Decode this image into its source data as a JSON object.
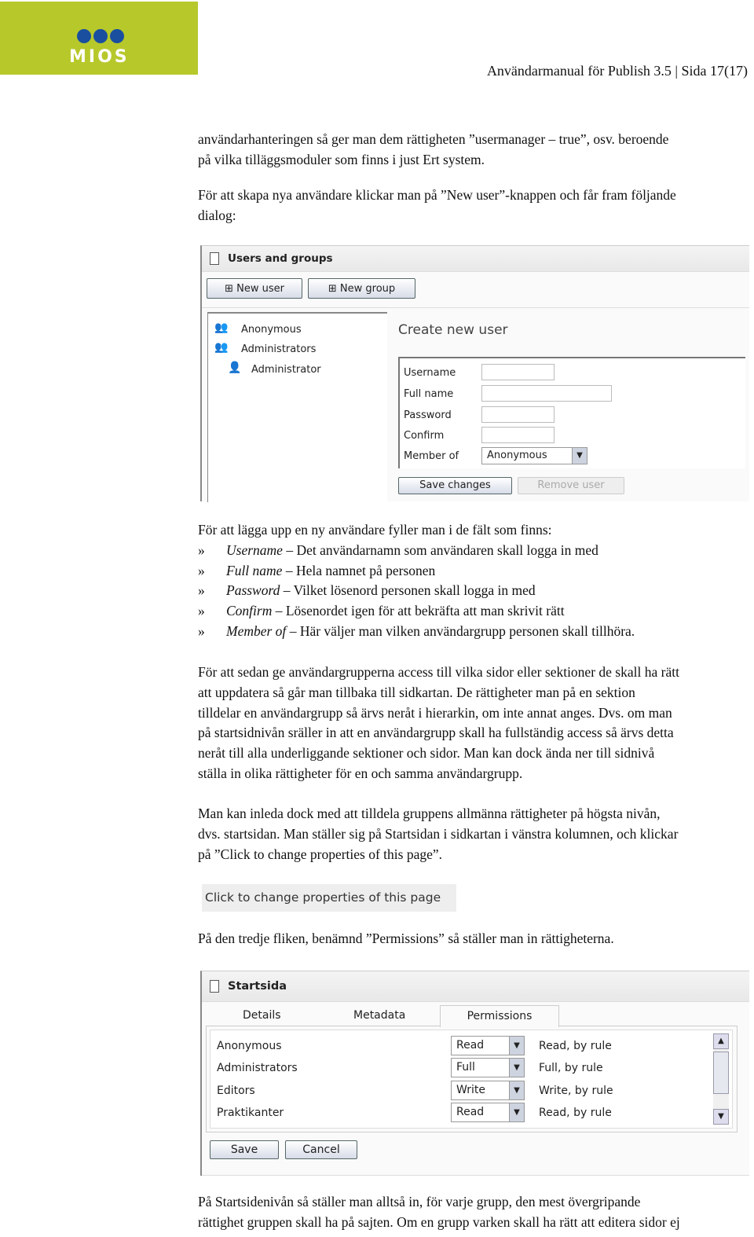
{
  "header": {
    "logo_text": "MIOS",
    "title": "Användarmanual för Publish 3.5 | Sida 17(17)",
    "brand_color": "#b7c82b"
  },
  "para1": [
    "användarhanteringen så ger man dem rättigheten ”usermanager – true”, osv. beroende",
    "på vilka tilläggsmoduler som finns i just Ert system."
  ],
  "para2": [
    "För att skapa nya användare klickar man på ”New user”-knappen och får fram följande",
    "dialog:"
  ],
  "users_dialog": {
    "title": "Users and groups",
    "new_user": "New user",
    "new_group": "New group",
    "tree": [
      "Anonymous",
      "Administrators",
      "Administrator"
    ],
    "form_title": "Create new user",
    "fields": [
      {
        "label": "Username"
      },
      {
        "label": "Full name"
      },
      {
        "label": "Password"
      },
      {
        "label": "Confirm"
      },
      {
        "label": "Member of",
        "value": "Anonymous"
      }
    ],
    "save": "Save changes",
    "remove": "Remove user"
  },
  "para3": "För att lägga upp en ny användare fyller man i de fält som finns:",
  "bullets": [
    {
      "marker": "»",
      "term": "Username",
      "text": " – Det användarnamn som användaren skall logga in med"
    },
    {
      "marker": "»",
      "term": "Full name",
      "text": " – Hela namnet på personen"
    },
    {
      "marker": "»",
      "term": "Password",
      "text": " – Vilket lösenord personen skall logga in med"
    },
    {
      "marker": "»",
      "term": "Confirm",
      "text": " – Lösenordet igen för att bekräfta att man skrivit rätt"
    },
    {
      "marker": "»",
      "term": "Member of",
      "text": " – Här väljer man vilken användargrupp personen skall tillhöra."
    }
  ],
  "para4": [
    "För att sedan ge användargrupperna access till vilka sidor eller sektioner de skall ha rätt",
    "att uppdatera så går man tillbaka till sidkartan. De rättigheter man på en sektion",
    "tilldelar en användargrupp så ärvs neråt i hierarkin, om inte annat anges. Dvs. om man",
    "på startsidnivån sräller in att en användargrupp skall ha fullständig access så ärvs detta",
    "neråt till alla underliggande sektioner och sidor. Man kan dock ända ner till sidnivå",
    "ställa in olika rättigheter för en och samma användargrupp."
  ],
  "para5": [
    "Man kan inleda dock med att tilldela gruppens allmänna rättigheter på högsta nivån,",
    "dvs. startsidan. Man ställer sig på Startsidan i sidkartan i vänstra kolumnen, och klickar",
    "på ”Click to change properties of this page”."
  ],
  "change_link": "Click to change properties of this page",
  "para6": "På den tredje fliken, benämnd ”Permissions” så ställer man in rättigheterna.",
  "perm_dialog": {
    "title": "Startsida",
    "tabs": [
      "Details",
      "Metadata",
      "Permissions"
    ],
    "active_tab": "Permissions",
    "rows": [
      {
        "group": "Anonymous",
        "value": "Read",
        "effective": "Read, by rule"
      },
      {
        "group": "Administrators",
        "value": "Full",
        "effective": "Full, by rule"
      },
      {
        "group": "Editors",
        "value": "Write",
        "effective": "Write, by rule"
      },
      {
        "group": "Praktikanter",
        "value": "Read",
        "effective": "Read, by rule"
      }
    ],
    "save": "Save",
    "cancel": "Cancel"
  },
  "para7": [
    "På Startsidenivån så ställer man alltså in, för varje grupp, den mest övergripande",
    "rättighet gruppen skall ha på sajten. Om en grupp varken skall ha rätt att editera sidor ej"
  ]
}
